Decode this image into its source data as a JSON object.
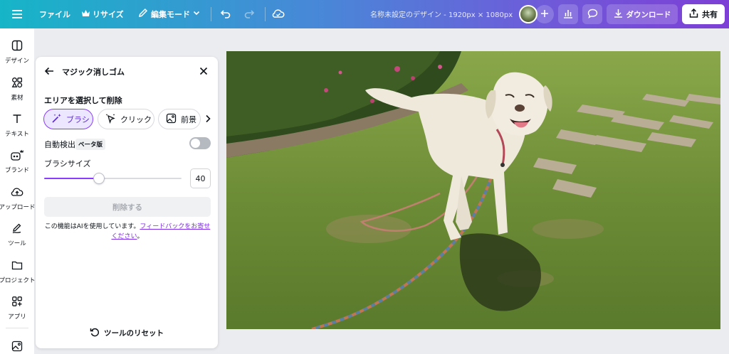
{
  "topbar": {
    "file_label": "ファイル",
    "resize_label": "リサイズ",
    "edit_mode_label": "編集モード",
    "doc_title": "名称未設定のデザイン - 1920px × 1080px",
    "download_label": "ダウンロード",
    "share_label": "共有"
  },
  "sidebar": {
    "items": [
      {
        "label": "デザイン",
        "icon": "design-icon"
      },
      {
        "label": "素材",
        "icon": "elements-icon"
      },
      {
        "label": "テキスト",
        "icon": "text-icon"
      },
      {
        "label": "ブランド",
        "icon": "brand-icon"
      },
      {
        "label": "アップロード",
        "icon": "upload-icon"
      },
      {
        "label": "ツール",
        "icon": "tools-icon"
      },
      {
        "label": "プロジェクト",
        "icon": "projects-icon"
      },
      {
        "label": "アプリ",
        "icon": "apps-icon"
      }
    ]
  },
  "panel": {
    "title": "マジック消しゴム",
    "section_title": "エリアを選択して削除",
    "modes": [
      {
        "label": "ブラシ",
        "active": true
      },
      {
        "label": "クリック",
        "active": false
      },
      {
        "label": "前景",
        "active": false
      }
    ],
    "auto_detect_label": "自動検出",
    "beta_label": "ベータ版",
    "auto_detect_on": false,
    "brush_size_label": "ブラシサイズ",
    "brush_size_value": "40",
    "brush_size_fraction": 0.4,
    "erase_button": "削除する",
    "ai_note_prefix": "この機能はAIを使用しています。",
    "ai_note_link": "フィードバックをお寄せください",
    "ai_note_suffix": "。",
    "reset_label": "ツールのリセット"
  },
  "colors": {
    "accent": "#8b3dff",
    "link": "#7d2ae8"
  }
}
